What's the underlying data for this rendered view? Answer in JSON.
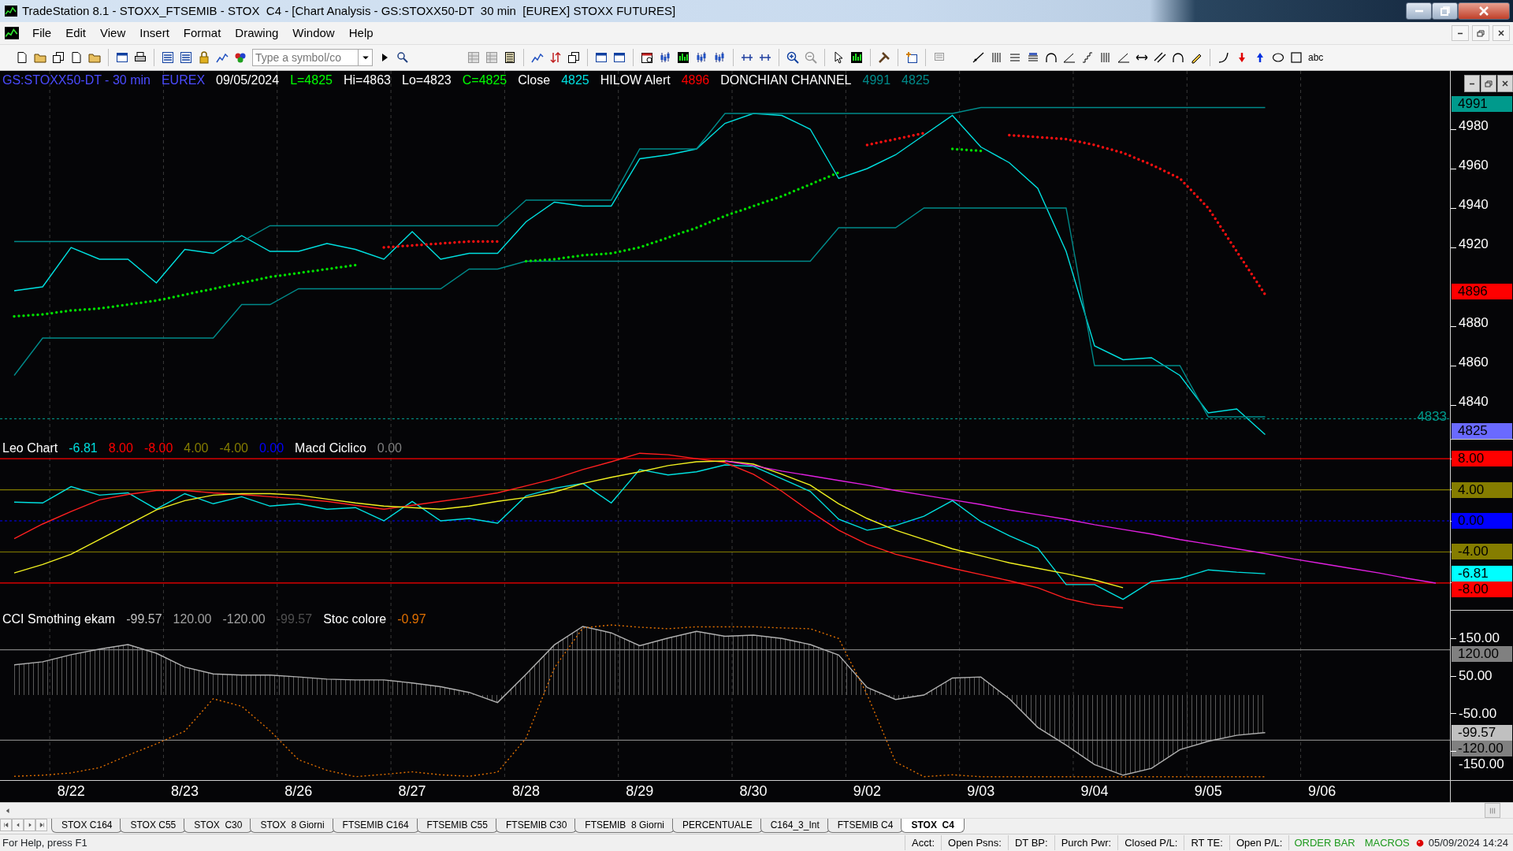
{
  "window": {
    "title": "TradeStation 8.1 - STOXX_FTSEMIB - STOX  C4 - [Chart Analysis - GS:STOXX50-DT  30 min  [EUREX] STOXX FUTURES]"
  },
  "menu": [
    "File",
    "Edit",
    "View",
    "Insert",
    "Format",
    "Drawing",
    "Window",
    "Help"
  ],
  "toolbar": {
    "symbol_field": {
      "placeholder": "Type a symbol/co"
    },
    "text_tool": "abc"
  },
  "price_pane": {
    "legend": [
      {
        "text": "GS:STOXX50-DT - 30 min",
        "color": "#4b4bff"
      },
      {
        "text": "EUREX",
        "color": "#4b4bff"
      },
      {
        "text": "09/05/2024",
        "color": "#ffffff"
      },
      {
        "text": "L=4825",
        "color": "#00ff00"
      },
      {
        "text": "Hi=4863",
        "color": "#ffffff"
      },
      {
        "text": "Lo=4823",
        "color": "#ffffff"
      },
      {
        "text": "C=4825",
        "color": "#00ff00"
      },
      {
        "text": "Close",
        "color": "#ffffff"
      },
      {
        "text": "4825",
        "color": "#00e0e0"
      },
      {
        "text": "HILOW Alert",
        "color": "#ffffff"
      },
      {
        "text": "4896",
        "color": "#ff0000"
      },
      {
        "text": "DONCHIAN CHANNEL",
        "color": "#ffffff"
      },
      {
        "text": "4991",
        "color": "#008b8b"
      },
      {
        "text": "4825",
        "color": "#008b8b"
      }
    ],
    "axis_markers": [
      {
        "text": "4991",
        "color": "#009a8c"
      },
      {
        "text": "4896",
        "color": "#ff0000"
      },
      {
        "text": "4825",
        "color": "#6a6aff"
      }
    ],
    "chart_data": {
      "type": "line",
      "grid": true,
      "ylim": [
        4822.8,
        5009.6
      ],
      "yticks": [
        4840,
        4860,
        4880,
        4920,
        4940,
        4960,
        4980
      ],
      "categories": [
        null,
        null,
        null,
        null,
        null,
        null,
        null,
        null,
        null,
        null,
        null,
        null,
        null,
        null,
        null,
        null,
        null,
        null,
        null,
        null,
        null,
        null,
        null,
        null,
        null,
        null,
        null,
        null,
        null,
        null,
        null,
        null,
        null,
        null,
        null,
        null,
        null,
        null,
        null,
        null,
        null,
        null,
        null,
        null,
        null,
        null,
        null,
        null,
        null,
        null,
        null
      ],
      "ref_lines": [
        {
          "axis": "y",
          "value": 4833,
          "label": "4833",
          "color": "#009a8c",
          "line_style": "dashed"
        }
      ],
      "series": [
        {
          "color": "#00e0e0",
          "values": [
            4898,
            4900,
            4920,
            4914,
            4914,
            4902,
            4919,
            4917,
            4926,
            4918,
            4918,
            4922,
            4919,
            4914,
            4928,
            4914,
            4917,
            4917,
            4933,
            4943,
            4941,
            4941,
            4965,
            4967,
            4970,
            4983,
            4988,
            4987,
            4980,
            4955,
            4960,
            4967,
            4977,
            4987,
            4971,
            4963,
            4950,
            4918,
            4870,
            4863,
            4864,
            4855,
            4836,
            4838,
            4825,
            null,
            null,
            null,
            null,
            null,
            null
          ]
        },
        {
          "color": "#008b8b",
          "values": [
            4923,
            4923,
            4923,
            4923,
            4923,
            4923,
            4923,
            4923,
            4923,
            4931,
            4931,
            4931,
            4931,
            4931,
            4931,
            4931,
            4931,
            4931,
            4944,
            4944,
            4944,
            4944,
            4970,
            4970,
            4970,
            4988,
            4988,
            4988,
            4988,
            4988,
            4988,
            4988,
            4988,
            4988,
            4991,
            4991,
            4991,
            4991,
            4991,
            4991,
            4991,
            4991,
            4991,
            4991,
            4991,
            null,
            null,
            null,
            null,
            null,
            null
          ]
        },
        {
          "color": "#008b8b",
          "values": [
            4855,
            4874,
            4874,
            4874,
            4874,
            4874,
            4874,
            4874,
            4891,
            4891,
            4899,
            4899,
            4899,
            4899,
            4899,
            4899,
            4909,
            4909,
            4913,
            4913,
            4913,
            4913,
            4913,
            4913,
            4913,
            4913,
            4913,
            4913,
            4913,
            4930,
            4930,
            4930,
            4940,
            4940,
            4940,
            4940,
            4940,
            4940,
            4860,
            4860,
            4860,
            4860,
            4834,
            4834,
            4834,
            null,
            null,
            null,
            null,
            null,
            null
          ]
        },
        {
          "color": "#00dd00",
          "line_style": "dotted",
          "values": [
            4885,
            4886,
            4888,
            4889,
            4891,
            4893,
            4896,
            4899,
            4902,
            4905,
            4907,
            4909,
            4911,
            null,
            null,
            null,
            null,
            null,
            4913,
            4914,
            4916,
            4917,
            4920,
            4925,
            4930,
            4936,
            4941,
            4946,
            4952,
            4958,
            null,
            null,
            null,
            4970,
            4969,
            null,
            null,
            null,
            null,
            null,
            null,
            null,
            null,
            null,
            null,
            null,
            null,
            null,
            null,
            null,
            null
          ]
        },
        {
          "color": "#ff1010",
          "line_style": "dotted",
          "values": [
            null,
            null,
            null,
            null,
            null,
            null,
            null,
            null,
            null,
            null,
            null,
            null,
            null,
            4920,
            4921,
            4922,
            4923,
            4923,
            null,
            null,
            null,
            null,
            null,
            null,
            null,
            null,
            null,
            null,
            null,
            null,
            4972,
            4975,
            4978,
            null,
            null,
            4977,
            4976,
            4975,
            4972,
            4968,
            4962,
            4955,
            4940,
            4918,
            4896,
            null,
            null,
            null,
            null,
            null,
            null
          ]
        }
      ]
    }
  },
  "macd_pane": {
    "legend": [
      {
        "text": "Leo Chart",
        "color": "#ffffff"
      },
      {
        "text": "-6.81",
        "color": "#00e0e0"
      },
      {
        "text": "8.00",
        "color": "#ff0000"
      },
      {
        "text": "-8.00",
        "color": "#ff0000"
      },
      {
        "text": "4.00",
        "color": "#857d00"
      },
      {
        "text": "-4.00",
        "color": "#857d00"
      },
      {
        "text": "0.00",
        "color": "#0000ff"
      },
      {
        "text": "Macd Ciclico",
        "color": "#ffffff"
      },
      {
        "text": "0.00",
        "color": "#808080"
      }
    ],
    "axis_markers": [
      {
        "text": "-6.81",
        "color": "#00ffff"
      }
    ],
    "chart_data": {
      "type": "line",
      "grid": true,
      "ylim": [
        -11.45,
        10.54
      ],
      "yticks": [
        {
          "value": 8,
          "label": "8.00"
        },
        {
          "value": 4,
          "label": "4.00"
        },
        {
          "value": 0,
          "label": "0.00"
        },
        {
          "value": -4,
          "label": "-4.00"
        },
        {
          "value": -8,
          "label": "-8.00"
        }
      ],
      "categories": [
        null,
        null,
        null,
        null,
        null,
        null,
        null,
        null,
        null,
        null,
        null,
        null,
        null,
        null,
        null,
        null,
        null,
        null,
        null,
        null,
        null,
        null,
        null,
        null,
        null,
        null,
        null,
        null,
        null,
        null,
        null,
        null,
        null,
        null,
        null,
        null,
        null,
        null,
        null,
        null,
        null,
        null,
        null,
        null,
        null,
        null,
        null,
        null,
        null,
        null,
        null
      ],
      "ref_lines": [
        {
          "axis": "y",
          "value": 8,
          "color": "#ff0000",
          "line_style": "solid"
        },
        {
          "axis": "y",
          "value": 4,
          "color": "#857d00",
          "line_style": "solid"
        },
        {
          "axis": "y",
          "value": 0,
          "color": "#0000ff",
          "line_style": "dashed"
        },
        {
          "axis": "y",
          "value": -4,
          "color": "#857d00",
          "line_style": "solid"
        },
        {
          "axis": "y",
          "value": -8,
          "color": "#ff0000",
          "line_style": "solid"
        }
      ],
      "series": [
        {
          "color": "#00e0e0",
          "values": [
            2.4,
            2.3,
            4.4,
            3.3,
            3.6,
            1.5,
            3.5,
            2.2,
            3.1,
            1.9,
            2.2,
            1.5,
            1.7,
            0.0,
            2.5,
            0,
            0.3,
            -0.3,
            3.2,
            4.2,
            4.8,
            2.3,
            6.6,
            5.9,
            6.3,
            7.2,
            7.0,
            5.4,
            3.8,
            0.2,
            -1.2,
            -0.6,
            0.6,
            2.6,
            -0.1,
            -1.9,
            -3.5,
            -8.2,
            -8.2,
            -10.1,
            -7.8,
            -7.4,
            -6.3,
            -6.6,
            -6.8,
            null,
            null,
            null,
            null,
            null,
            null
          ]
        },
        {
          "color": "#ff2020",
          "values": [
            -2.3,
            -0.4,
            1.2,
            2.7,
            3.4,
            3.9,
            3.9,
            3.6,
            3.4,
            3.1,
            2.8,
            2.5,
            2.0,
            1.5,
            2.0,
            2.5,
            3.0,
            3.6,
            4.5,
            5.4,
            6.6,
            7.6,
            8.7,
            8.5,
            8.0,
            7.5,
            6.0,
            3.8,
            1.2,
            -1.2,
            -3.0,
            -4.3,
            -5.2,
            -6.1,
            -6.9,
            -7.7,
            -8.6,
            -10.0,
            -10.8,
            -11.2,
            null,
            null,
            null,
            null,
            null,
            null,
            null,
            null,
            null,
            null,
            null
          ]
        },
        {
          "color": "#f0f020",
          "values": [
            -6.7,
            -5.6,
            -4.3,
            -2.4,
            -0.5,
            1.4,
            2.6,
            3.3,
            3.5,
            3.5,
            3.3,
            2.8,
            2.3,
            1.9,
            1.7,
            1.5,
            1.9,
            2.5,
            3.0,
            3.7,
            4.8,
            5.6,
            6.3,
            7.1,
            7.6,
            7.7,
            7.3,
            6.0,
            4.6,
            2.2,
            0.3,
            -1.2,
            -2.4,
            -3.6,
            -4.5,
            -5.4,
            -6.1,
            -6.8,
            -7.6,
            -8.6,
            null,
            null,
            null,
            null,
            null,
            null,
            null,
            null,
            null,
            null,
            null
          ]
        },
        {
          "color": "#e020e0",
          "values": [
            null,
            null,
            null,
            null,
            null,
            null,
            null,
            null,
            null,
            null,
            null,
            null,
            null,
            null,
            null,
            null,
            null,
            null,
            null,
            null,
            null,
            null,
            null,
            null,
            null,
            7.7,
            7.1,
            6.4,
            5.8,
            5.2,
            4.6,
            3.9,
            3.3,
            2.7,
            2.1,
            1.4,
            0.8,
            0.2,
            -0.5,
            -1.1,
            -1.7,
            -2.4,
            -3.0,
            -3.6,
            -4.2,
            -4.9,
            -5.5,
            -6.1,
            -6.7,
            -7.4,
            -8.0
          ]
        }
      ]
    }
  },
  "cci_pane": {
    "legend": [
      {
        "text": "CCI Smothing ekam",
        "color": "#ffffff"
      },
      {
        "text": "-99.57",
        "color": "#c0c0c0"
      },
      {
        "text": "120.00",
        "color": "#a0a0a0"
      },
      {
        "text": "-120.00",
        "color": "#a0a0a0"
      },
      {
        "text": "-99.57",
        "color": "#505050"
      },
      {
        "text": "Stoc colore",
        "color": "#ffffff"
      },
      {
        "text": "-0.97",
        "color": "#e07000"
      }
    ],
    "histogram": true,
    "ref_labels_on_axis": true,
    "axis_markers": [
      {
        "text": "-99.57",
        "color": "#c0c0c0"
      }
    ],
    "chart_data": {
      "type": "line",
      "grid": true,
      "ylim": [
        -226,
        226
      ],
      "yticks": [
        {
          "value": 150,
          "label": "150.00"
        },
        {
          "value": 50,
          "label": "50.00"
        },
        {
          "value": -50,
          "label": "-50.00"
        },
        {
          "value": -150,
          "label": "-150.00"
        }
      ],
      "categories": [
        null,
        null,
        "8/22",
        null,
        null,
        null,
        "8/23",
        null,
        null,
        null,
        "8/26",
        null,
        null,
        null,
        "8/27",
        null,
        null,
        null,
        "8/28",
        null,
        null,
        null,
        "8/29",
        null,
        null,
        null,
        "8/30",
        null,
        null,
        null,
        "9/02",
        null,
        null,
        null,
        "9/03",
        null,
        null,
        null,
        "9/04",
        null,
        null,
        null,
        "9/05",
        null,
        null,
        null,
        "9/06",
        null,
        null,
        null,
        null
      ],
      "ref_lines": [
        {
          "axis": "y",
          "value": 120,
          "label": "120.00",
          "color": "#808080",
          "line_style": "solid"
        },
        {
          "axis": "y",
          "value": -120,
          "label": "-120.00",
          "color": "#808080",
          "line_style": "solid"
        }
      ],
      "series": [
        {
          "color": "#b0b0b0",
          "values": [
            80,
            88,
            107,
            122,
            134,
            111,
            74,
            56,
            53,
            53,
            48,
            42,
            40,
            40,
            32,
            22,
            7,
            -20,
            55,
            133,
            182,
            165,
            131,
            151,
            169,
            156,
            159,
            150,
            134,
            106,
            20,
            -12,
            0,
            45,
            48,
            -10,
            -86,
            -133,
            -185,
            -213,
            -195,
            -145,
            -123,
            -107,
            -100,
            null,
            null,
            null,
            null,
            null,
            null
          ]
        },
        {
          "color": "#e07000",
          "line_style": "dashed",
          "values": [
            -216,
            -213,
            -207,
            -193,
            -160,
            -130,
            -96,
            -10,
            -30,
            -95,
            -172,
            -200,
            -217,
            -211,
            -204,
            -212,
            -216,
            -205,
            -115,
            72,
            178,
            186,
            180,
            176,
            181,
            181,
            181,
            178,
            176,
            150,
            1,
            -178,
            -217,
            -212,
            -217,
            -217,
            -217,
            -217,
            -217,
            -217,
            -217,
            -217,
            -217,
            -217,
            -217,
            null,
            null,
            null,
            null,
            null,
            null
          ]
        }
      ]
    }
  },
  "tabs": [
    {
      "label": "STOX C164",
      "selected": false
    },
    {
      "label": "STOX C55",
      "selected": false
    },
    {
      "label": "STOX  C30",
      "selected": false
    },
    {
      "label": "STOX  8 Giorni",
      "selected": false
    },
    {
      "label": "FTSEMIB C164",
      "selected": false
    },
    {
      "label": "FTSEMIB C55",
      "selected": false
    },
    {
      "label": "FTSEMIB C30",
      "selected": false
    },
    {
      "label": "FTSEMIB  8 Giorni",
      "selected": false
    },
    {
      "label": "PERCENTUALE",
      "selected": false
    },
    {
      "label": "C164_3_Int",
      "selected": false
    },
    {
      "label": "FTSEMIB C4",
      "selected": false
    },
    {
      "label": "STOX  C4",
      "selected": true
    }
  ],
  "status_bar": {
    "help": "For Help, press F1",
    "fields": [
      "Acct:",
      "Open Psns:",
      "DT BP:",
      "Purch Pwr:",
      "Closed P/L:",
      "RT TE:",
      "Open P/L:"
    ],
    "links": [
      "ORDER BAR",
      "MACROS"
    ],
    "datetime": "05/09/2024 14:24"
  }
}
